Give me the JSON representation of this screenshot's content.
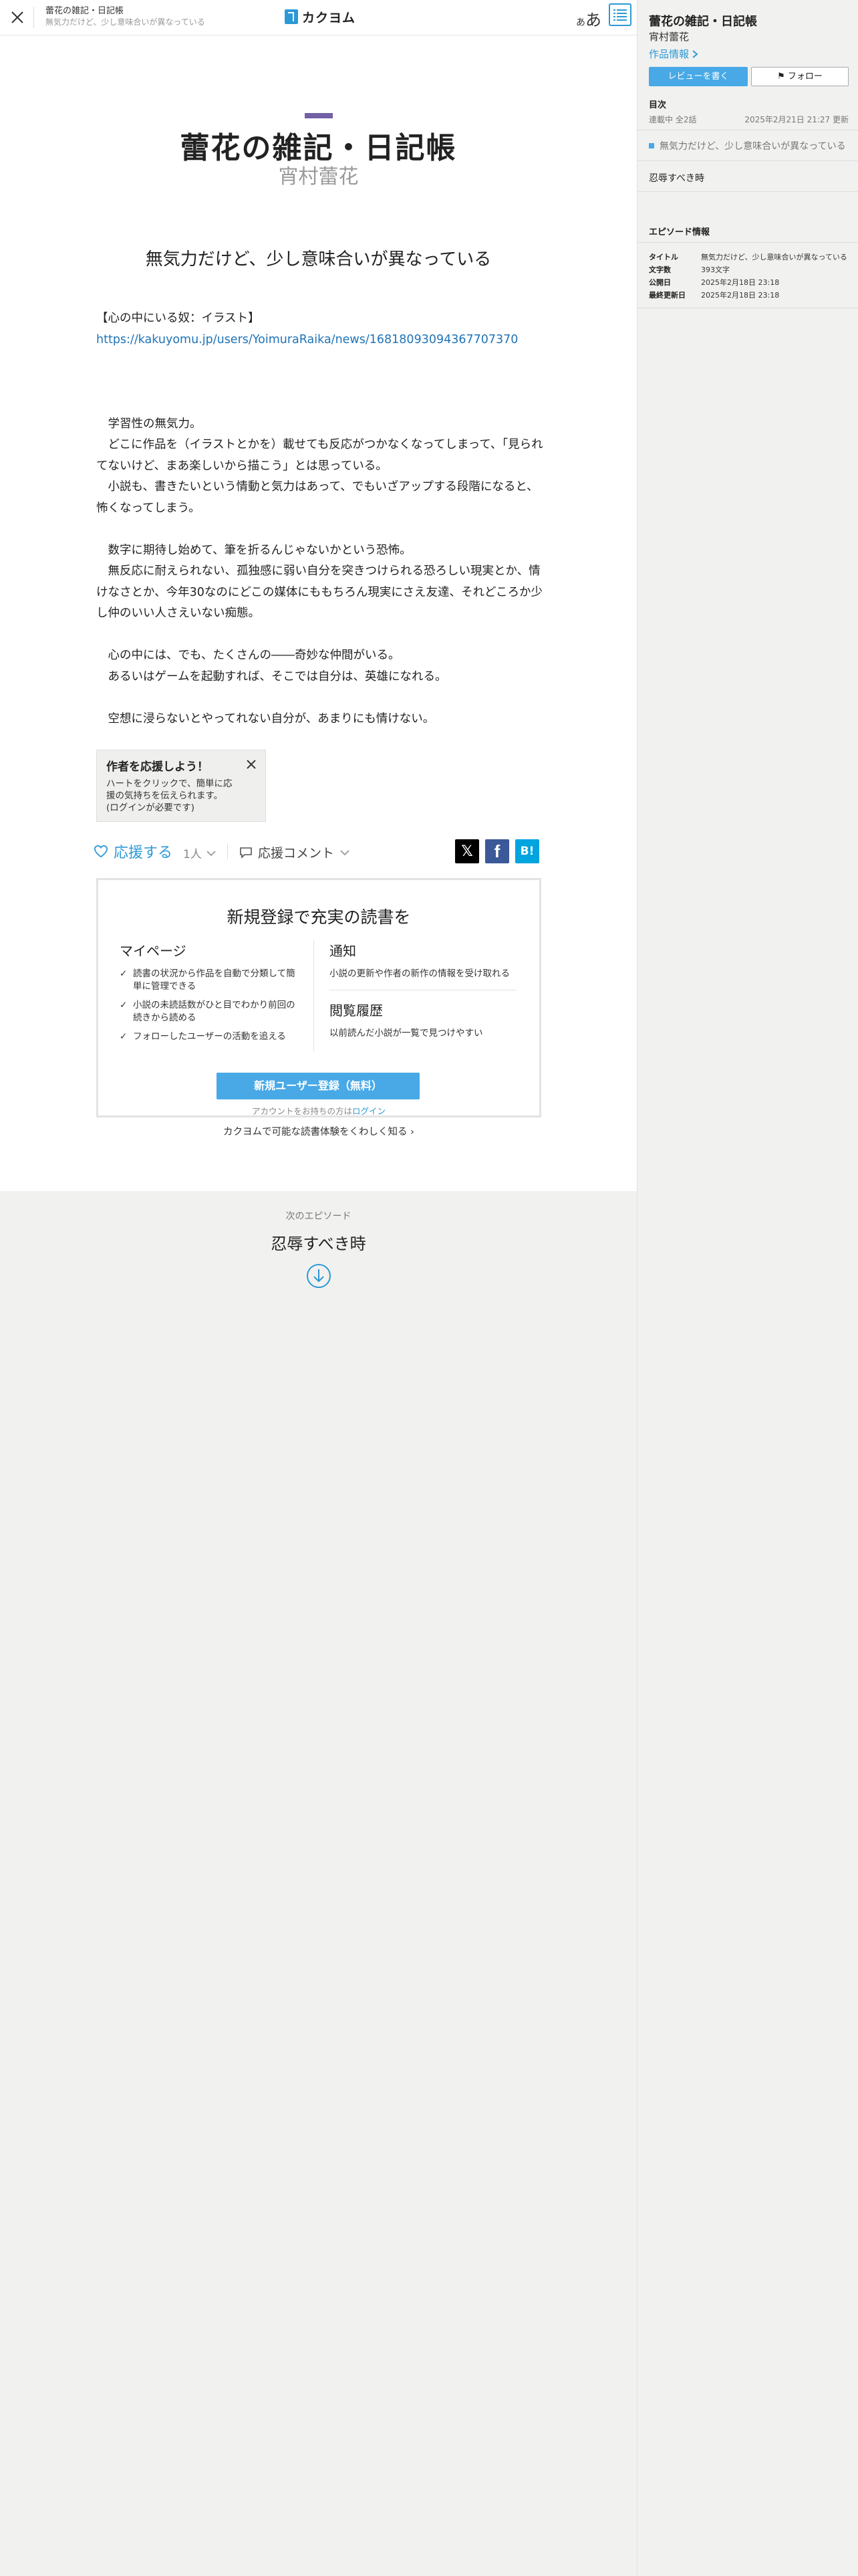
{
  "header": {
    "work_title": "蕾花の雑記・日記帳",
    "episode_title": "無気力だけど、少し意味合いが異なっている",
    "logo_text": "カクヨム",
    "font_button": "あ",
    "font_button_small": "あ"
  },
  "work": {
    "title": "蕾花の雑記・日記帳",
    "author": "宵村蕾花"
  },
  "episode": {
    "title": "無気力だけど、少し意味合いが異なっている",
    "intro": "【心の中にいる奴：イラスト】",
    "link": "https://kakuyomu.jp/users/YoimuraRaika/news/16818093094367707370",
    "paragraphs": [
      "　学習性の無気力。",
      "　どこに作品を（イラストとかを）載せても反応がつかなくなってしまって、「見られてないけど、まあ楽しいから描こう」とは思っている。",
      "　小説も、書きたいという情動と気力はあって、でもいざアップする段階になると、怖くなってしまう。",
      "",
      "　数字に期待し始めて、筆を折るんじゃないかという恐怖。",
      "　無反応に耐えられない、孤独感に弱い自分を突きつけられる恐ろしい現実とか、情けなさとか、今年30なのにどこの媒体にももちろん現実にさえ友達、それどころか少し仲のいい人さえいない痴態。",
      "",
      "　心の中には、でも、たくさんの――奇妙な仲間がいる。",
      "　あるいはゲームを起動すれば、そこでは自分は、英雄になれる。",
      "",
      "　空想に浸らないとやってれない自分が、あまりにも情けない。"
    ]
  },
  "cheer_tip": {
    "title": "作者を応援しよう！",
    "body": "ハートをクリックで、簡単に応援の気持ちを伝えられます。(ログインが必要です)"
  },
  "actions": {
    "cheer_label": "応援する",
    "cheer_count": "1人",
    "comment_label": "応援コメント",
    "share_x": "𝕏",
    "share_fb": "f",
    "share_hb": "B!"
  },
  "signup": {
    "title": "新規登録で充実の読書を",
    "mypage_heading": "マイページ",
    "mypage_features": [
      "読書の状況から作品を自動で分類して簡単に管理できる",
      "小説の未読話数がひと目でわかり前回の続きから読める",
      "フォローしたユーザーの活動を追える"
    ],
    "notify_heading": "通知",
    "notify_text": "小説の更新や作者の新作の情報を受け取れる",
    "history_heading": "閲覧履歴",
    "history_text": "以前読んだ小説が一覧で見つけやすい",
    "button": "新規ユーザー登録（無料）",
    "login_prefix": "アカウントをお持ちの方は",
    "login_link": "ログイン",
    "more": "カクヨムで可能な読書体験をくわしく知る"
  },
  "next": {
    "label": "次のエピソード",
    "title": "忍辱すべき時"
  },
  "sidebar": {
    "title": "蕾花の雑記・日記帳",
    "author": "宵村蕾花",
    "info_link": "作品情報",
    "review_button": "レビューを書く",
    "follow_button": "フォロー",
    "toc_heading": "目次",
    "status": "連載中 全2話",
    "updated": "2025年2月21日 21:27 更新",
    "episodes": [
      "無気力だけど、少し意味合いが異なっている",
      "忍辱すべき時"
    ],
    "episode_info_heading": "エピソード情報",
    "meta": [
      {
        "key": "タイトル",
        "value": "無気力だけど、少し意味合いが異なっている"
      },
      {
        "key": "文字数",
        "value": "393文字"
      },
      {
        "key": "公開日",
        "value": "2025年2月18日 23:18"
      },
      {
        "key": "最終更新日",
        "value": "2025年2月18日 23:18"
      }
    ]
  },
  "colors": {
    "accent": "#2c99d6",
    "button": "#48a9e6",
    "title_deco": "#7161a4",
    "page_bg": "#f1f1ef"
  }
}
